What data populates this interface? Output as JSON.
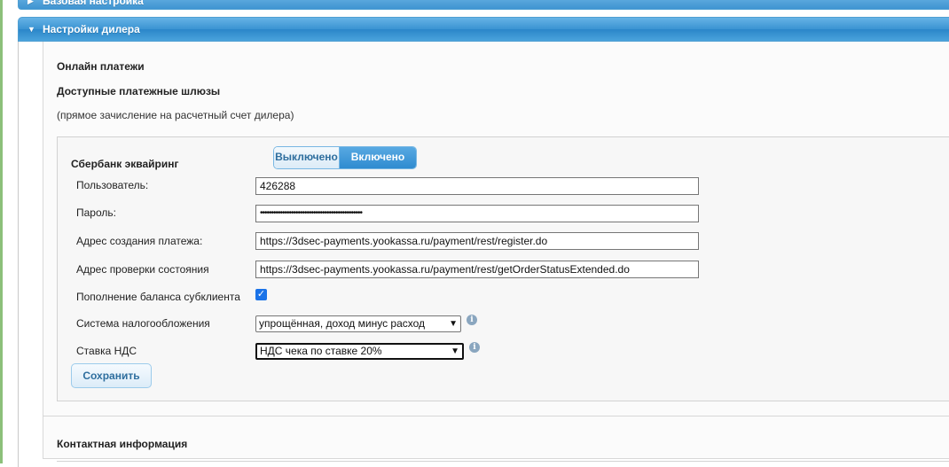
{
  "accordion": {
    "basic_settings": "Базовая настройка",
    "dealer_settings": "Настройки дилера"
  },
  "dealer": {
    "online_payments_title": "Онлайн платежи",
    "gateways_title": "Доступные платежные шлюзы",
    "gateways_note": "(прямое зачисление на расчетный счет дилера)",
    "contact_title": "Контактная информация"
  },
  "sberbank": {
    "title": "Сбербанк эквайринг",
    "toggle": {
      "off_label": "Выключено",
      "on_label": "Включено",
      "selected": "Включено"
    },
    "fields": {
      "user_label": "Пользователь:",
      "user_value": "426288",
      "password_label": "Пароль:",
      "password_value": "••••••••••••••••••••••••••••••••••••••••••••••",
      "create_url_label": "Адрес создания платежа:",
      "create_url_value": "https://3dsec-payments.yookassa.ru/payment/rest/register.do",
      "status_url_label": "Адрес проверки состояния",
      "status_url_value": "https://3dsec-payments.yookassa.ru/payment/rest/getOrderStatusExtended.do",
      "subclient_label": "Пополнение баланса субклиента",
      "subclient_checked": true,
      "tax_system_label": "Система налогообложения",
      "tax_system_value": "упрощённая, доход минус расход",
      "vat_label": "Ставка НДС",
      "vat_value": "НДС чека по ставке 20%"
    },
    "save_label": "Сохранить"
  },
  "icons": {
    "collapsed": "triangle-right-icon",
    "expanded": "triangle-down-icon",
    "info": "info-icon",
    "check": "checkmark-icon"
  },
  "colors": {
    "header_blue": "#3a93d2",
    "accent_text": "#2e6e9e",
    "checkbox": "#1a73e8"
  }
}
